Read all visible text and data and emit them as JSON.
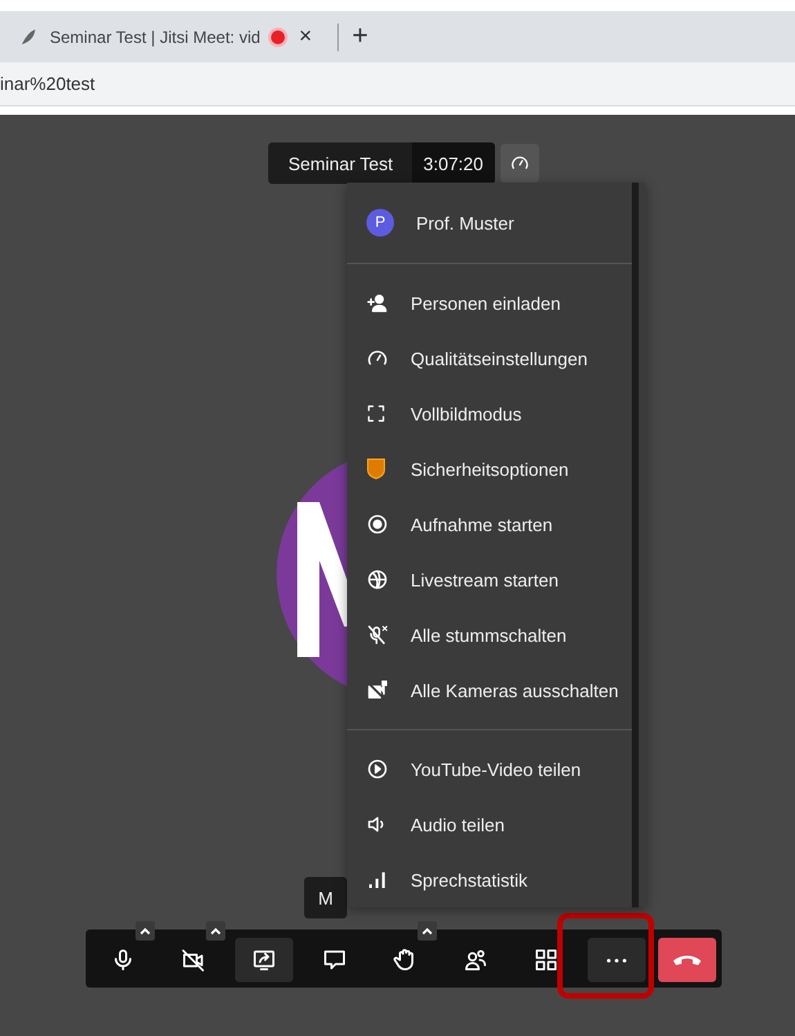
{
  "browser": {
    "tab": {
      "title": "Seminar Test | Jitsi Meet: vid",
      "recording": true,
      "close": "×"
    },
    "new_tab": "+",
    "url": "inar%20test"
  },
  "meeting": {
    "title": "Seminar Test",
    "timer": "3:07:20",
    "name_tag": "M"
  },
  "menu": {
    "user": {
      "initial": "P",
      "name": "Prof. Muster"
    },
    "sections": [
      {
        "items": [
          "Personen einladen",
          "Qualitätseinstellungen",
          "Vollbildmodus",
          "Sicherheitsoptionen",
          "Aufnahme starten",
          "Livestream starten",
          "Alle stummschalten",
          "Alle Kameras ausschalten"
        ]
      },
      {
        "items": [
          "YouTube-Video teilen",
          "Audio teilen",
          "Sprechstatistik"
        ]
      }
    ]
  },
  "toolbar": {
    "buttons": [
      {
        "kind": "mic",
        "caret": true,
        "selected": false,
        "highlighted": false
      },
      {
        "kind": "camera",
        "caret": true,
        "selected": false,
        "highlighted": false
      },
      {
        "kind": "share",
        "caret": false,
        "selected": true,
        "highlighted": false
      },
      {
        "kind": "chat",
        "caret": false,
        "selected": false,
        "highlighted": false
      },
      {
        "kind": "hand",
        "caret": true,
        "selected": false,
        "highlighted": false
      },
      {
        "kind": "participants",
        "caret": false,
        "selected": false,
        "highlighted": false
      },
      {
        "kind": "tiles",
        "caret": false,
        "selected": false,
        "highlighted": false
      },
      {
        "kind": "more",
        "caret": false,
        "selected": true,
        "highlighted": true
      },
      {
        "kind": "hangup",
        "caret": false,
        "selected": false,
        "highlighted": false
      }
    ]
  }
}
